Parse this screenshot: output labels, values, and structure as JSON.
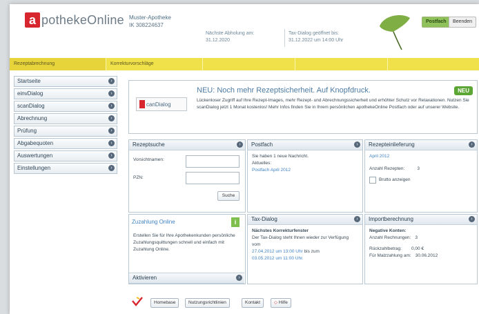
{
  "header": {
    "logo_initial": "a",
    "logo_text": "potheke",
    "logo_text2": "Online",
    "pharmacy_name": "Muster-Apotheke",
    "pharmacy_id": "IK 308224637",
    "next_billing_label": "Nächste Abholung am:",
    "next_billing_date": "31.12.2020",
    "dialog_label": "Tax-Dialog geöffnet bis:",
    "dialog_date": "31.12.2022 um 14:00 Uhr",
    "postfach_btn": "Postfach",
    "beenden_btn": "Beenden"
  },
  "nav": {
    "items": [
      "Rezeptabrechnung",
      "Korrekturvorschläge",
      "",
      "",
      ""
    ]
  },
  "sidebar": {
    "items": [
      "Startseite",
      "einvDialog",
      "scanDialog",
      "Abrechnung",
      "Prüfung",
      "Abgabequoten",
      "Auswertungen",
      "Einstellungen"
    ]
  },
  "news": {
    "logo_label": "canDialog",
    "title": "NEU: Noch mehr Rezeptsicherheit. Auf Knopfdruck.",
    "badge": "NEU",
    "body": "Lückenloser Zugriff auf Ihre Rezept-Images, mehr Rezept- und Abrechnungssicherheit und erhöhter Schutz vor Retaxationen. Nutzen Sie scanDialog jetzt 1 Monat kostenlos! Mehr Infos finden Sie in Ihrem persönlichen apothekeOnline Postfach oder auf unserer Website."
  },
  "rezeptsuche": {
    "title": "Rezeptsuche",
    "field1_label": "Vorsichtnamen:",
    "field2_label": "PZN:",
    "button": "Suche"
  },
  "postfach": {
    "title": "Postfach",
    "line1": "Sie haben 1 neue Nachricht.",
    "line2": "Aktuelles:",
    "link": "Postfach April 2012"
  },
  "rezepteinlieferung": {
    "title": "Rezepteinlieferung",
    "month": "April 2012",
    "count_label": "Anzahl Rezepten:",
    "count_value": "3",
    "checkbox_label": "Brutto anzeigen"
  },
  "zuzahlung": {
    "title": "Zuzahlung Online",
    "body": "Erstellen Sie für Ihre Apothekenkunden persönliche Zuzahlungsquittungen schnell und einfach mit Zuzahlung Online.",
    "action": "Aktivieren"
  },
  "taxdialog": {
    "title": "Tax-Dialog",
    "subtitle": "Nächstes Korrekturfenster",
    "body1": "Der Tax-Dialog steht Ihnen wieder zur Verfügung vom",
    "from": "27.04.2012 um 13:00 Uhr",
    "bis": "bis zum",
    "to": "03.05.2012 um 11:00 Uhr."
  },
  "import": {
    "title": "Importberechnung",
    "subtitle": "Negative Konten:",
    "count_label": "Anzahl Rechnungen:",
    "count_value": "3",
    "amount_label": "Rückzahlbetrag:",
    "amount_value": "0,00 €",
    "date_label": "Für Malzzahlung am:",
    "date_value": "30.06.2012"
  },
  "footer": {
    "buttons": [
      "Homebase",
      "Nutzungsrichtlinien",
      "Kontakt",
      "Hilfe"
    ]
  }
}
